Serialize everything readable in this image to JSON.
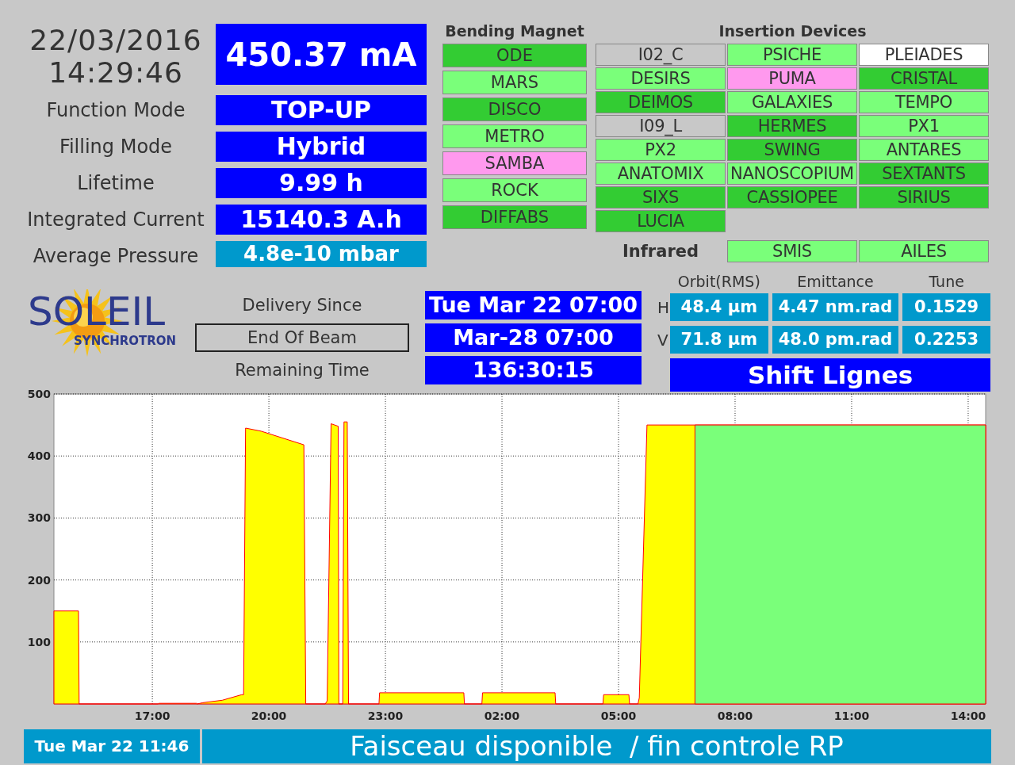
{
  "clock": {
    "date": "22/03/2016",
    "time": "14:29:46"
  },
  "beam_current": "450.37 mA",
  "parameters": [
    {
      "label": "Function Mode",
      "value": "TOP-UP",
      "kind": "primary"
    },
    {
      "label": "Filling Mode",
      "value": "Hybrid",
      "kind": "primary"
    },
    {
      "label": "Lifetime",
      "value": "9.99 h",
      "kind": "primary"
    },
    {
      "label": "Integrated Current",
      "value": "15140.3 A.h",
      "kind": "primary"
    },
    {
      "label": "Average Pressure",
      "value": "4.8e-10 mbar",
      "kind": "secondary"
    }
  ],
  "bending_magnet": {
    "title": "Bending Magnet",
    "beamlines": [
      {
        "name": "ODE",
        "color": "#33cc33"
      },
      {
        "name": "MARS",
        "color": "#7aff7a"
      },
      {
        "name": "DISCO",
        "color": "#33cc33"
      },
      {
        "name": "METRO",
        "color": "#7aff7a"
      },
      {
        "name": "SAMBA",
        "color": "#ff99ee"
      },
      {
        "name": "ROCK",
        "color": "#7aff7a"
      },
      {
        "name": "DIFFABS",
        "color": "#33cc33"
      }
    ]
  },
  "insertion_devices": {
    "title": "Insertion Devices",
    "beamlines": [
      {
        "name": "I02_C",
        "color": "#c8c8c8"
      },
      {
        "name": "PSICHE",
        "color": "#7aff7a"
      },
      {
        "name": "PLEIADES",
        "color": "#ffffff"
      },
      {
        "name": "DESIRS",
        "color": "#7aff7a"
      },
      {
        "name": "PUMA",
        "color": "#ff99ee"
      },
      {
        "name": "CRISTAL",
        "color": "#33cc33"
      },
      {
        "name": "DEIMOS",
        "color": "#33cc33"
      },
      {
        "name": "GALAXIES",
        "color": "#7aff7a"
      },
      {
        "name": "TEMPO",
        "color": "#7aff7a"
      },
      {
        "name": "I09_L",
        "color": "#c8c8c8"
      },
      {
        "name": "HERMES",
        "color": "#33cc33"
      },
      {
        "name": "PX1",
        "color": "#7aff7a"
      },
      {
        "name": "PX2",
        "color": "#7aff7a"
      },
      {
        "name": "SWING",
        "color": "#33cc33"
      },
      {
        "name": "ANTARES",
        "color": "#7aff7a"
      },
      {
        "name": "ANATOMIX",
        "color": "#7aff7a"
      },
      {
        "name": "NANOSCOPIUM",
        "color": "#7aff7a"
      },
      {
        "name": "SEXTANTS",
        "color": "#33cc33"
      },
      {
        "name": "SIXS",
        "color": "#33cc33"
      },
      {
        "name": "CASSIOPEE",
        "color": "#33cc33"
      },
      {
        "name": "SIRIUS",
        "color": "#33cc33"
      },
      {
        "name": "LUCIA",
        "color": "#33cc33"
      }
    ]
  },
  "infrared": {
    "label": "Infrared",
    "beamlines": [
      {
        "name": "SMIS",
        "color": "#7aff7a"
      },
      {
        "name": "AILES",
        "color": "#7aff7a"
      }
    ]
  },
  "logo": {
    "name": "SOLEIL",
    "subtitle": "SYNCHROTRON"
  },
  "delivery": [
    {
      "label": "Delivery Since",
      "value": "Tue Mar 22 07:00",
      "boxed": false
    },
    {
      "label": "End Of Beam",
      "value": "Mar-28 07:00",
      "boxed": true
    },
    {
      "label": "Remaining Time",
      "value": "136:30:15",
      "boxed": false
    }
  ],
  "beam_quality": {
    "columns": [
      "Orbit(RMS)",
      "Emittance",
      "Tune"
    ],
    "rows": [
      {
        "plane": "H",
        "values": [
          "48.4 µm",
          "4.47 nm.rad",
          "0.1529"
        ]
      },
      {
        "plane": "V",
        "values": [
          "71.8 µm",
          "48.0 pm.rad",
          "0.2253"
        ]
      }
    ]
  },
  "operator_mode": "Shift Lignes",
  "chart_data": {
    "type": "area",
    "grid": true,
    "xlim": [
      "2016-03-22 14:28",
      "2016-03-23 14:27"
    ],
    "ylim": [
      0,
      500
    ],
    "yticks": [
      100,
      200,
      300,
      400,
      500
    ],
    "xticks": [
      {
        "value": "2016-03-22 17:00",
        "label": "17:00"
      },
      {
        "value": "2016-03-22 20:00",
        "label": "20:00"
      },
      {
        "value": "2016-03-22 23:00",
        "label": "23:00"
      },
      {
        "value": "2016-03-23 02:00",
        "label": "02:00"
      },
      {
        "value": "2016-03-23 05:00",
        "label": "05:00"
      },
      {
        "value": "2016-03-23 08:00",
        "label": "08:00"
      },
      {
        "value": "2016-03-23 11:00",
        "label": "11:00"
      },
      {
        "value": "2016-03-23 14:00",
        "label": "14:00"
      }
    ],
    "x": [
      "2016-03-22 14:28",
      "2016-03-22 15:06",
      "2016-03-22 15:07",
      "2016-03-22 17:09",
      "2016-03-22 17:10",
      "2016-03-22 18:08",
      "2016-03-22 18:09",
      "2016-03-22 18:18",
      "2016-03-22 18:48",
      "2016-03-22 19:18",
      "2016-03-22 19:21",
      "2016-03-22 19:24",
      "2016-03-22 19:48",
      "2016-03-22 20:54",
      "2016-03-22 20:57",
      "2016-03-22 21:27",
      "2016-03-22 21:30",
      "2016-03-22 21:36",
      "2016-03-22 21:47",
      "2016-03-22 21:48",
      "2016-03-22 21:54",
      "2016-03-22 21:56",
      "2016-03-22 22:01",
      "2016-03-22 22:03",
      "2016-03-22 22:50",
      "2016-03-22 22:51",
      "2016-03-23 01:01",
      "2016-03-23 01:02",
      "2016-03-23 01:29",
      "2016-03-23 01:30",
      "2016-03-23 03:22",
      "2016-03-23 03:23",
      "2016-03-23 04:36",
      "2016-03-23 04:37",
      "2016-03-23 05:16",
      "2016-03-23 05:17",
      "2016-03-23 05:30",
      "2016-03-23 05:32",
      "2016-03-23 05:44",
      "2016-03-23 06:58",
      "2016-03-23 14:27"
    ],
    "series": [
      {
        "color": "#ffff00",
        "values": [
          150,
          150,
          0,
          0,
          1,
          1,
          0,
          2,
          6,
          15,
          15,
          445,
          440,
          418,
          0,
          0,
          5,
          452,
          448,
          0,
          0,
          455,
          455,
          0,
          0,
          18,
          18,
          0,
          0,
          18,
          18,
          0,
          0,
          15,
          15,
          0,
          0,
          10,
          450,
          450,
          450
        ]
      },
      {
        "color": "#7aff7a",
        "values": [
          null,
          null,
          null,
          null,
          null,
          null,
          null,
          null,
          null,
          null,
          null,
          null,
          null,
          null,
          null,
          null,
          null,
          null,
          null,
          null,
          null,
          null,
          null,
          null,
          null,
          null,
          null,
          null,
          null,
          null,
          null,
          null,
          null,
          null,
          null,
          null,
          null,
          null,
          null,
          450,
          450
        ]
      }
    ]
  },
  "status_bar": {
    "timestamp": "Tue Mar 22 11:46",
    "message": "Faisceau disponible  / fin controle RP"
  }
}
